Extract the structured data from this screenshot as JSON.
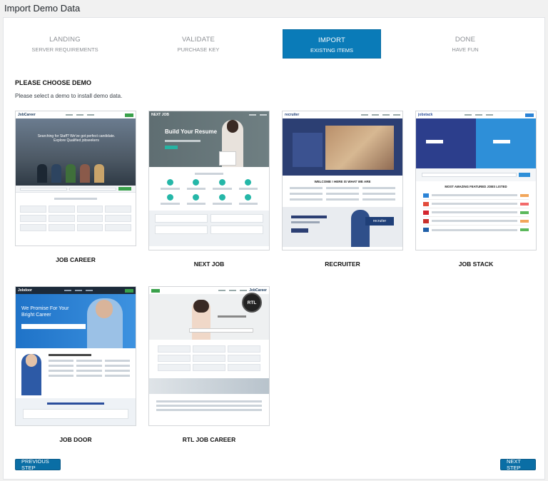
{
  "page": {
    "title": "Import Demo Data"
  },
  "steps": [
    {
      "title": "LANDING",
      "subtitle": "SERVER REQUIREMENTS",
      "active": false
    },
    {
      "title": "VALIDATE",
      "subtitle": "PURCHASE KEY",
      "active": false
    },
    {
      "title": "IMPORT",
      "subtitle": "EXISTING ITEMS",
      "active": true
    },
    {
      "title": "DONE",
      "subtitle": "HAVE FUN",
      "active": false
    }
  ],
  "section": {
    "title": "PLEASE CHOOSE DEMO",
    "subtitle": "Please select a demo to install demo data."
  },
  "demos": [
    {
      "name": "JOB CAREER",
      "logo": "JobCareer",
      "headline": "Searching for Staff? We've got perfect candidate. Explore Qualified jobseekers"
    },
    {
      "name": "NEXT JOB",
      "logo": "NEXT JOB",
      "headline": "Build Your Resume"
    },
    {
      "name": "RECRUITER",
      "logo": "recruiter",
      "headline": "WELCOME ! HERE IS WHAT WE ARE"
    },
    {
      "name": "JOB STACK",
      "logo": "jobstack",
      "headline": "MOST AMAZING FEATURED JOBS LISTED"
    },
    {
      "name": "JOB DOOR",
      "logo": "Jobdoor",
      "headline": "We Promise For Your Bright Career"
    },
    {
      "name": "RTL JOB CAREER",
      "logo": "JobCareer",
      "badge": "RTL"
    }
  ],
  "buttons": {
    "previous": "PREVIOUS STEP",
    "next": "NEXT STEP"
  },
  "colors": {
    "accent": "#0a7bb8",
    "background": "#f1f1f1",
    "panel": "#ffffff"
  }
}
